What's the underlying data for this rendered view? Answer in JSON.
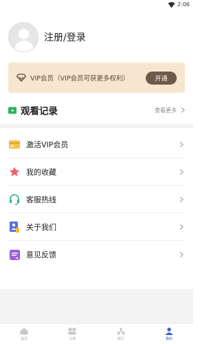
{
  "status_bar": {
    "time": "2:06",
    "wifi_icon": "wifi-icon"
  },
  "profile": {
    "login_label": "注册/登录",
    "avatar_icon": "avatar-icon"
  },
  "vip_banner": {
    "text": "VIP会员（VIP会员可获更多权利）",
    "button_label": "开通",
    "icon": "diamond-icon"
  },
  "history": {
    "title": "观看记录",
    "more_label": "查看更多",
    "icon": "film-icon"
  },
  "menu": {
    "items": [
      {
        "label": "激活VIP会员",
        "icon": "card-icon"
      },
      {
        "label": "我的收藏",
        "icon": "star-icon"
      },
      {
        "label": "客服热线",
        "icon": "headset-icon"
      },
      {
        "label": "关于我们",
        "icon": "about-icon"
      },
      {
        "label": "意见反馈",
        "icon": "feedback-icon"
      }
    ]
  },
  "tabbar": {
    "tabs": [
      {
        "label": "首页",
        "icon": "home-icon",
        "active": false
      },
      {
        "label": "分类",
        "icon": "category-icon",
        "active": false
      },
      {
        "label": "排行",
        "icon": "rank-icon",
        "active": false
      },
      {
        "label": "我的",
        "icon": "profile-icon",
        "active": true
      }
    ]
  },
  "colors": {
    "vip_bg": "#f7e6cf",
    "vip_button": "#6e5a4a",
    "active_tab": "#3b5ccc"
  }
}
